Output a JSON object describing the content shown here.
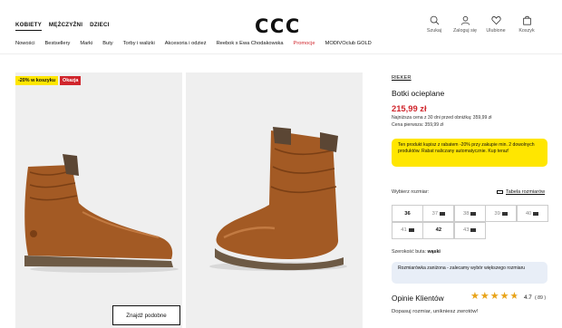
{
  "header": {
    "gender_tabs": [
      {
        "label": "KOBIETY",
        "active": true
      },
      {
        "label": "MĘŻCZYŹNI",
        "active": false
      },
      {
        "label": "DZIECI",
        "active": false
      }
    ],
    "logo": "CCC",
    "icons": [
      {
        "icon": "search-icon",
        "label": "Szukaj"
      },
      {
        "icon": "user-icon",
        "label": "Zaloguj się"
      },
      {
        "icon": "heart-icon",
        "label": "Ulubione"
      },
      {
        "icon": "bag-icon",
        "label": "Koszyk"
      }
    ],
    "nav": [
      "Nowości",
      "Bestsellery",
      "Marki",
      "Buty",
      "Torby i walizki",
      "Akcesoria i odzież",
      "Reebok x Ewa Chodakowska",
      "Promocje",
      "MODIVOclub GOLD"
    ]
  },
  "gallery": {
    "badge_discount": "-20% w koszyku",
    "badge_offer": "Okazja",
    "similar_button": "Znajdź podobne"
  },
  "product": {
    "brand": "RIEKER",
    "name": "Botki ocieplane",
    "price": "215,99 zł",
    "lowest_price": "Najniższa cena z 30 dni przed obniżką: 359,99 zł",
    "first_price": "Cena pierwsza: 359,99 zł",
    "promo_text": "Ten produkt kupisz z rabatem -20% przy zakupie min. 2 dowolnych produktów. Rabat naliczany automatycznie. Kup teraz!",
    "size_label": "Wybierz rozmiar:",
    "size_table_label": "Tabela rozmiarów",
    "sizes": [
      {
        "size": "36",
        "available": true
      },
      {
        "size": "37",
        "available": false
      },
      {
        "size": "38",
        "available": false
      },
      {
        "size": "39",
        "available": false
      },
      {
        "size": "40",
        "available": false
      },
      {
        "size": "41",
        "available": false
      },
      {
        "size": "42",
        "available": true
      },
      {
        "size": "43",
        "available": false
      }
    ],
    "width_label": "Szerokość buta:",
    "width_value": "wąski",
    "size_note": "Rozmiarówka zaniżona - zalecamy wybór większego rozmiaru",
    "opinions_title": "Opinie Klientów",
    "rating": "4.7",
    "rating_count": "( 89 )",
    "rating_value": 4.7,
    "review_snippet": "Dopasuj rozmiar, unikniesz zwrotów!"
  },
  "colors": {
    "accent": "#d0252c",
    "promo_bg": "#ffe600",
    "note_bg": "#e8eef7",
    "star": "#e8a319",
    "boot": "#a35a24"
  }
}
